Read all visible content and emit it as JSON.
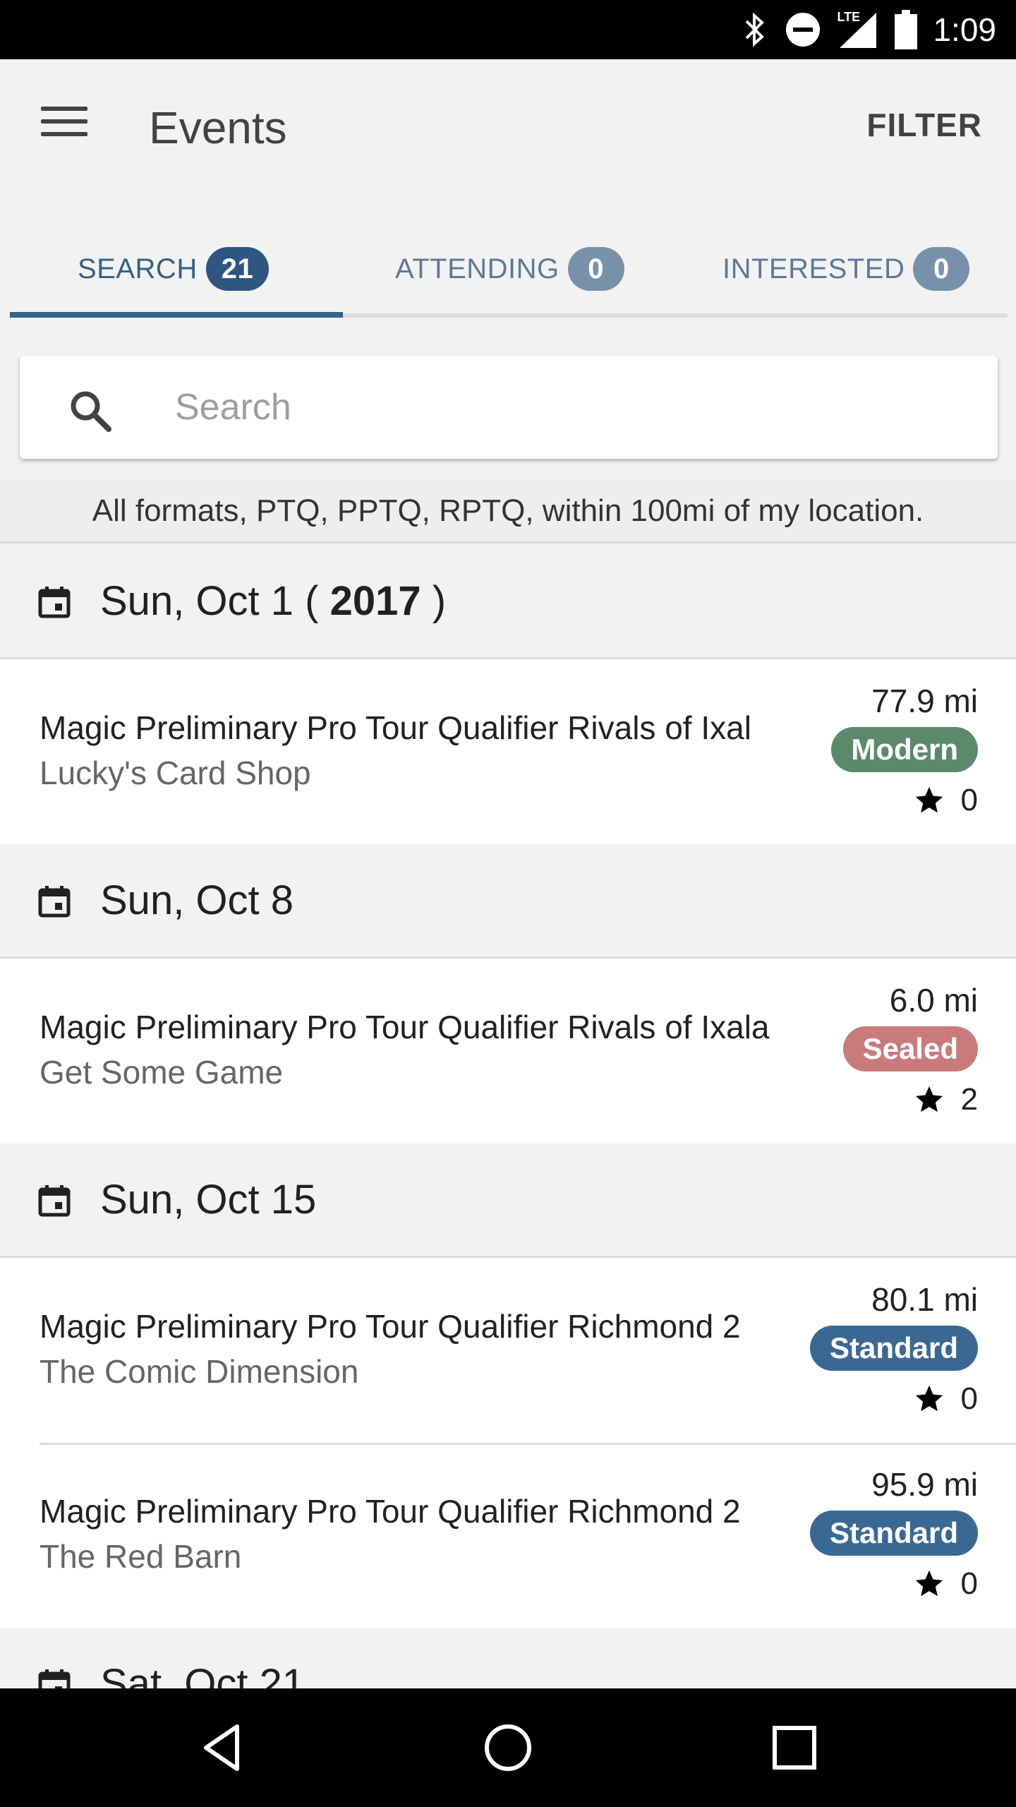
{
  "status_bar": {
    "time": "1:09",
    "icons": [
      "bluetooth-icon",
      "do-not-disturb-icon",
      "lte-signal-icon",
      "battery-icon"
    ],
    "lte_label": "LTE"
  },
  "app_bar": {
    "title": "Events",
    "filter_label": "FILTER"
  },
  "tabs": [
    {
      "label": "SEARCH",
      "count": "21",
      "active": true
    },
    {
      "label": "ATTENDING",
      "count": "0",
      "active": false
    },
    {
      "label": "INTERESTED",
      "count": "0",
      "active": false
    }
  ],
  "search": {
    "placeholder": "Search",
    "value": ""
  },
  "filter_summary": "All formats, PTQ, PPTQ, RPTQ, within 100mi of my location.",
  "colors": {
    "accent": "#35618a",
    "badge_active": "#2f5680",
    "badge_inactive": "#7891ab",
    "modern": "#5b8a6a",
    "sealed": "#c97b7b",
    "standard": "#3a6894"
  },
  "groups": [
    {
      "date": "Sun, Oct 1",
      "year_prefix": " ( ",
      "year": "2017",
      "year_suffix": " )",
      "events": [
        {
          "title": "Magic Preliminary Pro Tour Qualifier Rivals of Ixal",
          "store": "Lucky's Card Shop",
          "distance": "77.9 mi",
          "format": "Modern",
          "interested": "0"
        }
      ]
    },
    {
      "date": "Sun, Oct 8",
      "events": [
        {
          "title": "Magic Preliminary Pro Tour Qualifier Rivals of Ixala",
          "store": "Get Some Game",
          "distance": "6.0 mi",
          "format": "Sealed",
          "interested": "2"
        }
      ]
    },
    {
      "date": "Sun, Oct 15",
      "events": [
        {
          "title": "Magic Preliminary Pro Tour Qualifier Richmond 2",
          "store": "The Comic Dimension",
          "distance": "80.1 mi",
          "format": "Standard",
          "interested": "0"
        },
        {
          "title": "Magic Preliminary Pro Tour Qualifier Richmond 2",
          "store": "The Red Barn",
          "distance": "95.9 mi",
          "format": "Standard",
          "interested": "0"
        }
      ]
    },
    {
      "date": "Sat, Oct 21",
      "events": []
    }
  ],
  "nav_bar": {
    "buttons": [
      "back-icon",
      "home-icon",
      "recents-icon"
    ]
  }
}
